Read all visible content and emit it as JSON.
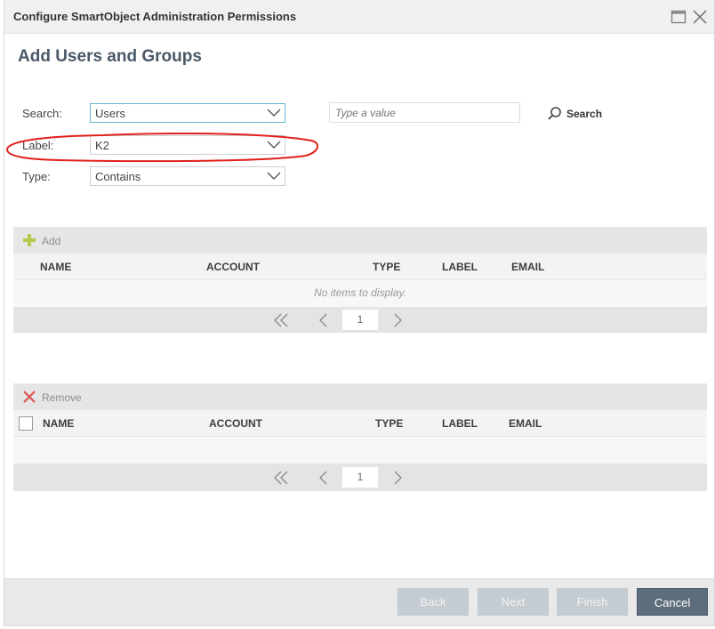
{
  "window": {
    "title": "Configure SmartObject Administration Permissions",
    "maximize_icon": "maximize-icon",
    "close_icon": "close-icon"
  },
  "heading": "Add Users and Groups",
  "form": {
    "search": {
      "label": "Search:",
      "value": "Users"
    },
    "label": {
      "label": "Label:",
      "value": "K2"
    },
    "type": {
      "label": "Type:",
      "value": "Contains"
    },
    "text_input": {
      "placeholder": "Type a value"
    },
    "search_button": {
      "label": "Search",
      "icon": "search-icon"
    }
  },
  "available_grid": {
    "toolbar_label": "Add",
    "toolbar_icon": "plus-icon",
    "columns": [
      "NAME",
      "ACCOUNT",
      "TYPE",
      "LABEL",
      "EMAIL"
    ],
    "empty_message": "No items to display.",
    "page": "1"
  },
  "selected_grid": {
    "toolbar_label": "Remove",
    "toolbar_icon": "x-icon",
    "columns": [
      "NAME",
      "ACCOUNT",
      "TYPE",
      "LABEL",
      "EMAIL"
    ],
    "page": "1"
  },
  "footer": {
    "back": "Back",
    "next": "Next",
    "finish": "Finish",
    "cancel": "Cancel"
  },
  "colors": {
    "annotation": "#e0201b",
    "primary_button": "#5e6d7b",
    "disabled_button": "#c4cbd1",
    "focus_border": "#6bb3d3",
    "add_icon": "#b5c94a",
    "remove_icon": "#d9534f"
  }
}
